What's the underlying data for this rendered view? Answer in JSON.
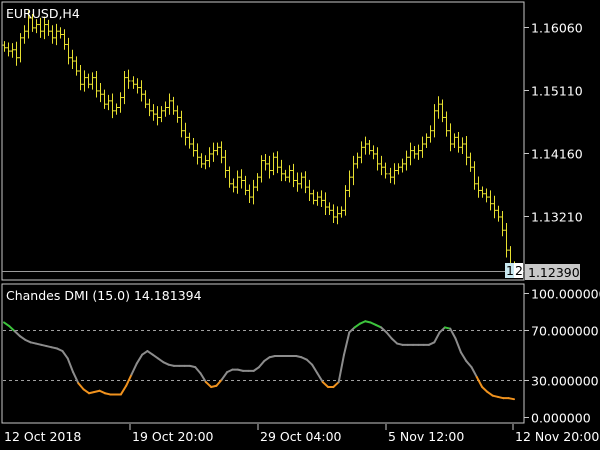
{
  "main_panel": {
    "symbol_label": "EURUSD,H4",
    "price_axis_ticks": [
      "1.16060",
      "1.15110",
      "1.14160",
      "1.13210"
    ],
    "current_price": "1.12390",
    "current_bar_tags": [
      "1",
      "2"
    ]
  },
  "indicator_panel": {
    "title": "Chandes DMI (15.0) 14.181394",
    "axis_ticks": [
      "100.000000",
      "70.000000",
      "30.000000",
      "0.000000"
    ]
  },
  "time_axis": {
    "labels": [
      "12 Oct 2018",
      "19 Oct 20:00",
      "29 Oct 04:00",
      "5 Nov 12:00",
      "12 Nov 20:00"
    ]
  },
  "colors": {
    "background": "#000000",
    "candles": "#e8e030",
    "frame": "#c8c8c8",
    "dmi_neutral": "#8c8c8c",
    "dmi_overbought": "#3cc43c",
    "dmi_oversold": "#f0921e",
    "level_lines": "#a0a0a0",
    "price_box_bg": "#c8c8c8"
  },
  "chart_data": [
    {
      "type": "candlestick",
      "title": "EURUSD,H4",
      "ylim": [
        1.1225,
        1.1644
      ],
      "yticks": [
        1.1606,
        1.1511,
        1.1416,
        1.1321
      ],
      "last_price": 1.1239,
      "series": [
        {
          "values": [
            1.1575,
            1.157,
            1.1572,
            1.156,
            1.159,
            1.16,
            1.162,
            1.1605,
            1.161,
            1.16,
            1.161,
            1.16,
            1.159,
            1.16,
            1.1595,
            1.158,
            1.156,
            1.1555,
            1.154,
            1.152,
            1.153,
            1.152,
            1.153,
            1.151,
            1.1505,
            1.149,
            1.1495,
            1.148,
            1.1485,
            1.15,
            1.153,
            1.1525,
            1.152,
            1.1515,
            1.1505,
            1.149,
            1.148,
            1.1475,
            1.147,
            1.148,
            1.1485,
            1.1495,
            1.148,
            1.147,
            1.145,
            1.144,
            1.143,
            1.142,
            1.141,
            1.14,
            1.1405,
            1.1415,
            1.142,
            1.1425,
            1.141,
            1.139,
            1.137,
            1.1365,
            1.138,
            1.1375,
            1.136,
            1.135,
            1.1365,
            1.138,
            1.1405,
            1.14,
            1.139,
            1.141,
            1.1395,
            1.1385,
            1.138,
            1.139,
            1.1375,
            1.137,
            1.138,
            1.1365,
            1.1355,
            1.1345,
            1.135,
            1.1345,
            1.1335,
            1.133,
            1.132,
            1.1325,
            1.133,
            1.136,
            1.138,
            1.14,
            1.141,
            1.1425,
            1.143,
            1.142,
            1.1415,
            1.14,
            1.1395,
            1.1385,
            1.138,
            1.139,
            1.1395,
            1.14,
            1.141,
            1.142,
            1.1415,
            1.142,
            1.143,
            1.144,
            1.145,
            1.148,
            1.149,
            1.147,
            1.145,
            1.143,
            1.144,
            1.1425,
            1.143,
            1.141,
            1.1395,
            1.137,
            1.136,
            1.1355,
            1.135,
            1.134,
            1.133,
            1.132,
            1.13,
            1.127,
            1.1245,
            1.1239
          ]
        }
      ]
    },
    {
      "type": "line",
      "title": "Chandes DMI (15.0) 14.181394",
      "ylim": [
        -5,
        107
      ],
      "yticks": [
        100,
        70,
        30,
        0
      ],
      "levels": [
        70,
        30
      ],
      "bands": {
        "overbought_above": 70,
        "oversold_below": 30
      },
      "series": [
        {
          "values": [
            76,
            73,
            69,
            65,
            62,
            60,
            59,
            58,
            57,
            56,
            55,
            53,
            47,
            36,
            27,
            22,
            19,
            20,
            21,
            19,
            18,
            18,
            18,
            25,
            34,
            43,
            50,
            53,
            50,
            47,
            44,
            42,
            41,
            41,
            41,
            41,
            40,
            35,
            28,
            24,
            25,
            30,
            36,
            38,
            38,
            37,
            37,
            37,
            40,
            45,
            48,
            49,
            49,
            49,
            49,
            49,
            48,
            46,
            42,
            35,
            28,
            24,
            24,
            28,
            50,
            68,
            72,
            75,
            77,
            76,
            74,
            72,
            68,
            63,
            59,
            58,
            58,
            58,
            58,
            58,
            58,
            60,
            68,
            72,
            71,
            63,
            52,
            45,
            40,
            32,
            24,
            20,
            17,
            16,
            15,
            15,
            14.2
          ]
        }
      ]
    }
  ]
}
